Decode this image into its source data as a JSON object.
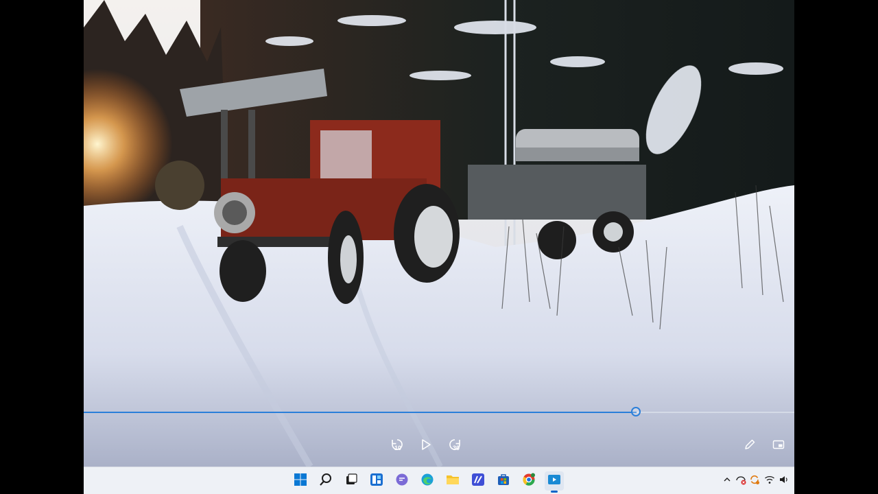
{
  "player": {
    "progress": 0.778,
    "skip_back_label": "10",
    "skip_forward_label": "30",
    "controls": {
      "skip_back": "skip-back-10-icon",
      "play": "play-icon",
      "skip_forward": "skip-forward-30-icon",
      "edit": "pencil-icon",
      "mini_view": "mini-view-icon"
    },
    "accent_color": "#2b7fd9"
  },
  "taskbar": {
    "apps": [
      {
        "name": "start",
        "icon": "windows-start-icon"
      },
      {
        "name": "search",
        "icon": "search-icon"
      },
      {
        "name": "task-view",
        "icon": "task-view-icon"
      },
      {
        "name": "widgets",
        "icon": "widgets-icon"
      },
      {
        "name": "teams-chat",
        "icon": "chat-icon"
      },
      {
        "name": "edge",
        "icon": "edge-browser-icon"
      },
      {
        "name": "file-explorer",
        "icon": "folder-icon"
      },
      {
        "name": "app-blue",
        "icon": "blue-app-icon"
      },
      {
        "name": "store",
        "icon": "store-icon"
      },
      {
        "name": "chrome",
        "icon": "chrome-icon"
      },
      {
        "name": "media-player",
        "icon": "media-player-icon"
      }
    ],
    "tray": [
      "chevron-up-icon",
      "network-error-icon",
      "update-icon",
      "wifi-icon",
      "volume-icon"
    ]
  }
}
